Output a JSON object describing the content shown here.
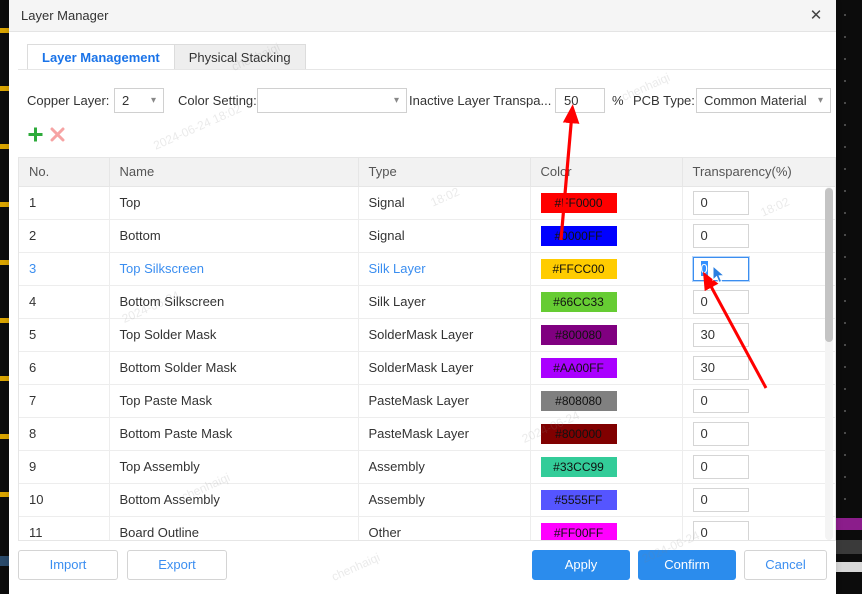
{
  "window": {
    "title": "Layer Manager",
    "close_icon": "close-icon"
  },
  "tabs": [
    {
      "label": "Layer Management",
      "active": true
    },
    {
      "label": "Physical Stacking",
      "active": false
    }
  ],
  "settings": {
    "copper_layer_label": "Copper Layer:",
    "copper_layer_value": "2",
    "color_setting_label": "Color Setting:",
    "color_setting_value": "",
    "inactive_transparency_label": "Inactive Layer Transpa...",
    "inactive_transparency_value": "50",
    "percent_symbol": "%",
    "pcb_type_label": "PCB Type:",
    "pcb_type_value": "Common Material"
  },
  "toolbar": {
    "add_icon": "plus-icon",
    "delete_icon": "delete-x-icon"
  },
  "table": {
    "columns": [
      "No.",
      "Name",
      "Type",
      "Color",
      "Transparency(%)"
    ],
    "rows": [
      {
        "no": "1",
        "name": "Top",
        "type": "Signal",
        "color": "#FF0000",
        "transparency": "0",
        "selected": false
      },
      {
        "no": "2",
        "name": "Bottom",
        "type": "Signal",
        "color": "#0000FF",
        "transparency": "0",
        "selected": false
      },
      {
        "no": "3",
        "name": "Top Silkscreen",
        "type": "Silk Layer",
        "color": "#FFCC00",
        "transparency": "0",
        "selected": true
      },
      {
        "no": "4",
        "name": "Bottom Silkscreen",
        "type": "Silk Layer",
        "color": "#66CC33",
        "transparency": "0",
        "selected": false
      },
      {
        "no": "5",
        "name": "Top Solder Mask",
        "type": "SolderMask Layer",
        "color": "#800080",
        "transparency": "30",
        "selected": false
      },
      {
        "no": "6",
        "name": "Bottom Solder Mask",
        "type": "SolderMask Layer",
        "color": "#AA00FF",
        "transparency": "30",
        "selected": false
      },
      {
        "no": "7",
        "name": "Top Paste Mask",
        "type": "PasteMask Layer",
        "color": "#808080",
        "transparency": "0",
        "selected": false
      },
      {
        "no": "8",
        "name": "Bottom Paste Mask",
        "type": "PasteMask Layer",
        "color": "#800000",
        "transparency": "0",
        "selected": false
      },
      {
        "no": "9",
        "name": "Top Assembly",
        "type": "Assembly",
        "color": "#33CC99",
        "transparency": "0",
        "selected": false
      },
      {
        "no": "10",
        "name": "Bottom Assembly",
        "type": "Assembly",
        "color": "#5555FF",
        "transparency": "0",
        "selected": false
      },
      {
        "no": "11",
        "name": "Board Outline",
        "type": "Other",
        "color": "#FF00FF",
        "transparency": "0",
        "selected": false
      }
    ],
    "focused_cell_row": 3,
    "focused_cell_value": "0"
  },
  "footer": {
    "import_label": "Import",
    "export_label": "Export",
    "apply_label": "Apply",
    "confirm_label": "Confirm",
    "cancel_label": "Cancel"
  },
  "colors": {
    "accent_blue": "#2b8ced",
    "link_blue": "#3b8ef0",
    "annotation_red": "#ff0000",
    "add_green": "#2eab3b",
    "delete_pink": "#f6a3a3"
  },
  "annotations": [
    {
      "name": "arrow-to-inactive-transparency",
      "color": "#ff0000"
    },
    {
      "name": "arrow-to-row3-transparency",
      "color": "#ff0000"
    }
  ],
  "watermarks": [
    "2024-06-24 18:02",
    "chenhaiqi",
    "2024-06-24",
    "18:02",
    "chenhaiqi",
    "2024-06-24",
    "chenhaiqi",
    "18:02",
    "2024-06-24",
    "chenhaiqi"
  ]
}
